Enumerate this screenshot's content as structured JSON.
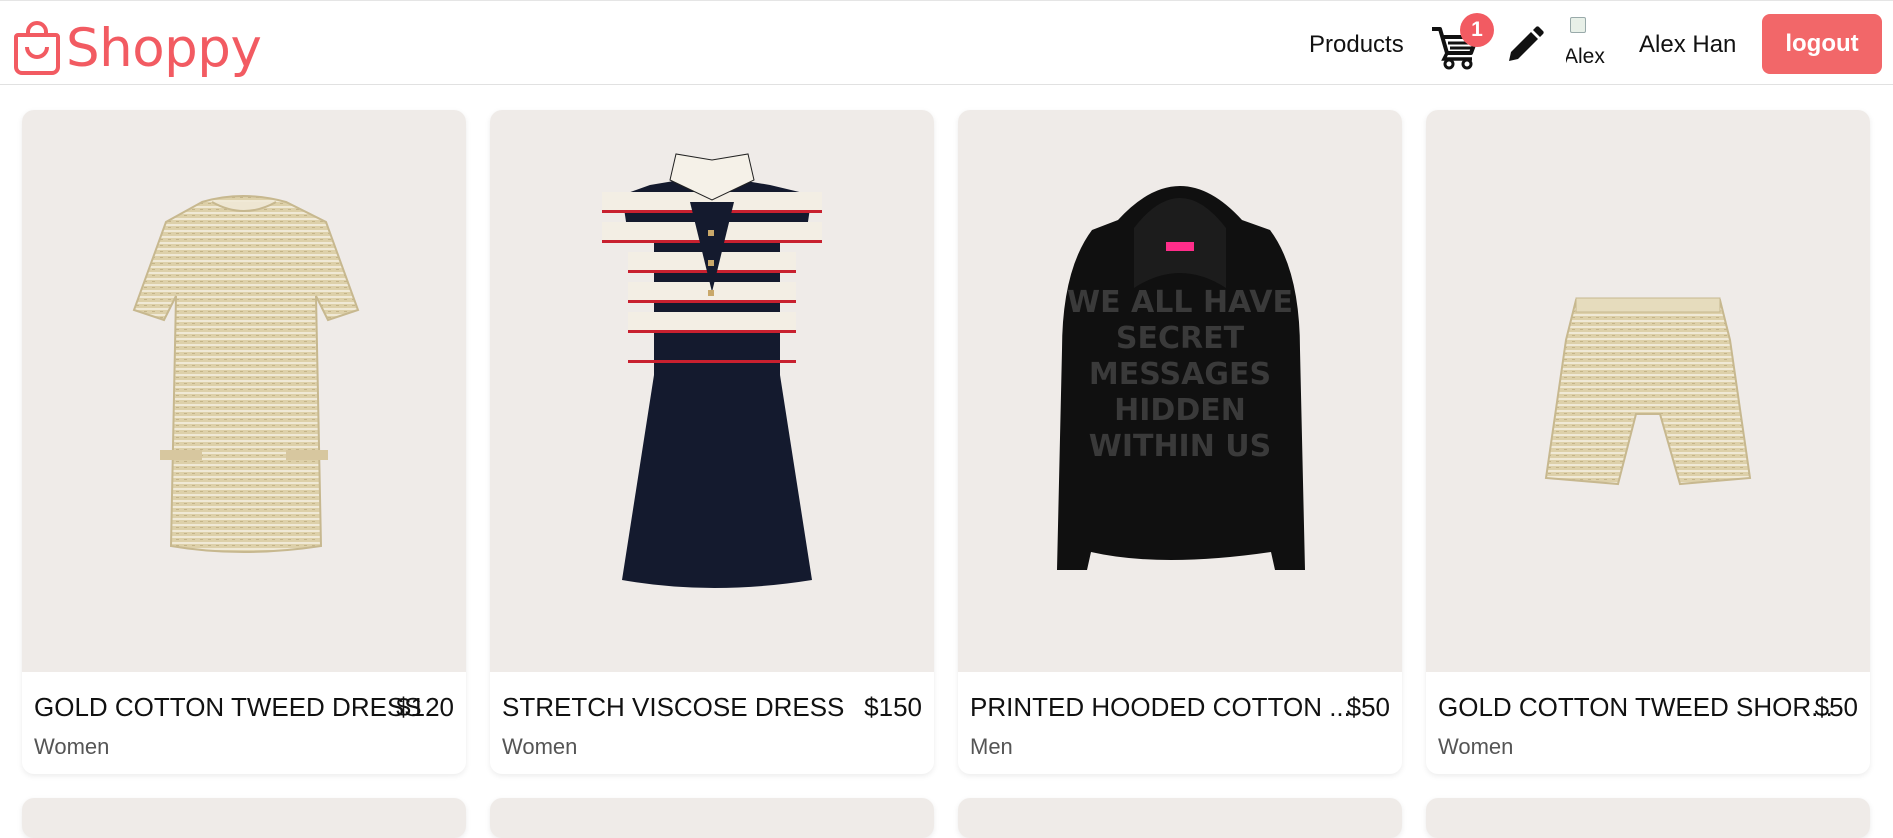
{
  "header": {
    "logo_text": "Shoppy",
    "nav_products": "Products",
    "cart_count": "1",
    "avatar_alt": "Alex",
    "user_name": "Alex Han",
    "logout_label": "logout",
    "icons": [
      "shopping-bag-icon",
      "cart-icon",
      "pencil-icon",
      "avatar-image"
    ]
  },
  "colors": {
    "brand": "#f25b62",
    "logout_bg": "#f26769",
    "card_bg": "#efebe8"
  },
  "products": [
    {
      "title": "GOLD COTTON TWEED DRESS",
      "price": "$120",
      "category": "Women"
    },
    {
      "title": "STRETCH VISCOSE DRESS",
      "price": "$150",
      "category": "Women"
    },
    {
      "title": "PRINTED HOODED COTTON ...",
      "price": "$50",
      "category": "Men"
    },
    {
      "title": "GOLD COTTON TWEED SHOR...",
      "price": "$50",
      "category": "Women"
    }
  ],
  "hoodie_print": [
    "WE ALL HAVE",
    "SECRET",
    "MESSAGES",
    "HIDDEN",
    "WITHIN US"
  ]
}
